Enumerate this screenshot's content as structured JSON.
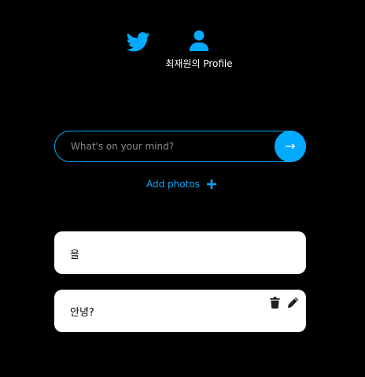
{
  "nav": {
    "home_icon": "twitter-bird-icon",
    "profile_icon": "user-icon",
    "profile_label": "최재원의 Profile"
  },
  "composer": {
    "placeholder": "What's on your mind?",
    "submit_label": "→",
    "add_photos_label": "Add photos",
    "add_photos_icon": "plus-icon"
  },
  "tweets": [
    {
      "text": "을"
    },
    {
      "text": "안녕?",
      "actions": [
        "trash-icon",
        "pencil-icon"
      ]
    }
  ],
  "colors": {
    "accent": "#04aaff",
    "background": "#000000",
    "card": "#ffffff",
    "card_text": "#000000"
  }
}
